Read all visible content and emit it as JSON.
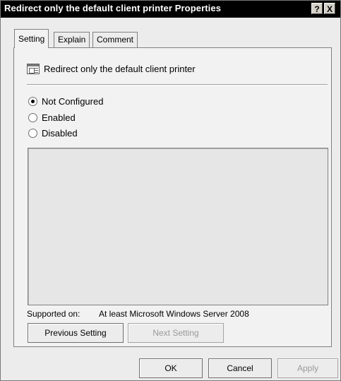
{
  "dialog": {
    "title": "Redirect only the default client printer Properties",
    "help_label": "?",
    "close_label": "X"
  },
  "tabs": [
    {
      "label": "Setting",
      "active": true
    },
    {
      "label": "Explain",
      "active": false
    },
    {
      "label": "Comment",
      "active": false
    }
  ],
  "setting": {
    "policy_name": "Redirect only the default client printer",
    "options": [
      {
        "label": "Not Configured",
        "checked": true
      },
      {
        "label": "Enabled",
        "checked": false
      },
      {
        "label": "Disabled",
        "checked": false
      }
    ],
    "supported_label": "Supported on:",
    "supported_value": "At least Microsoft Windows Server 2008",
    "previous_label": "Previous Setting",
    "next_label": "Next Setting"
  },
  "footer": {
    "ok_label": "OK",
    "cancel_label": "Cancel",
    "apply_label": "Apply"
  }
}
